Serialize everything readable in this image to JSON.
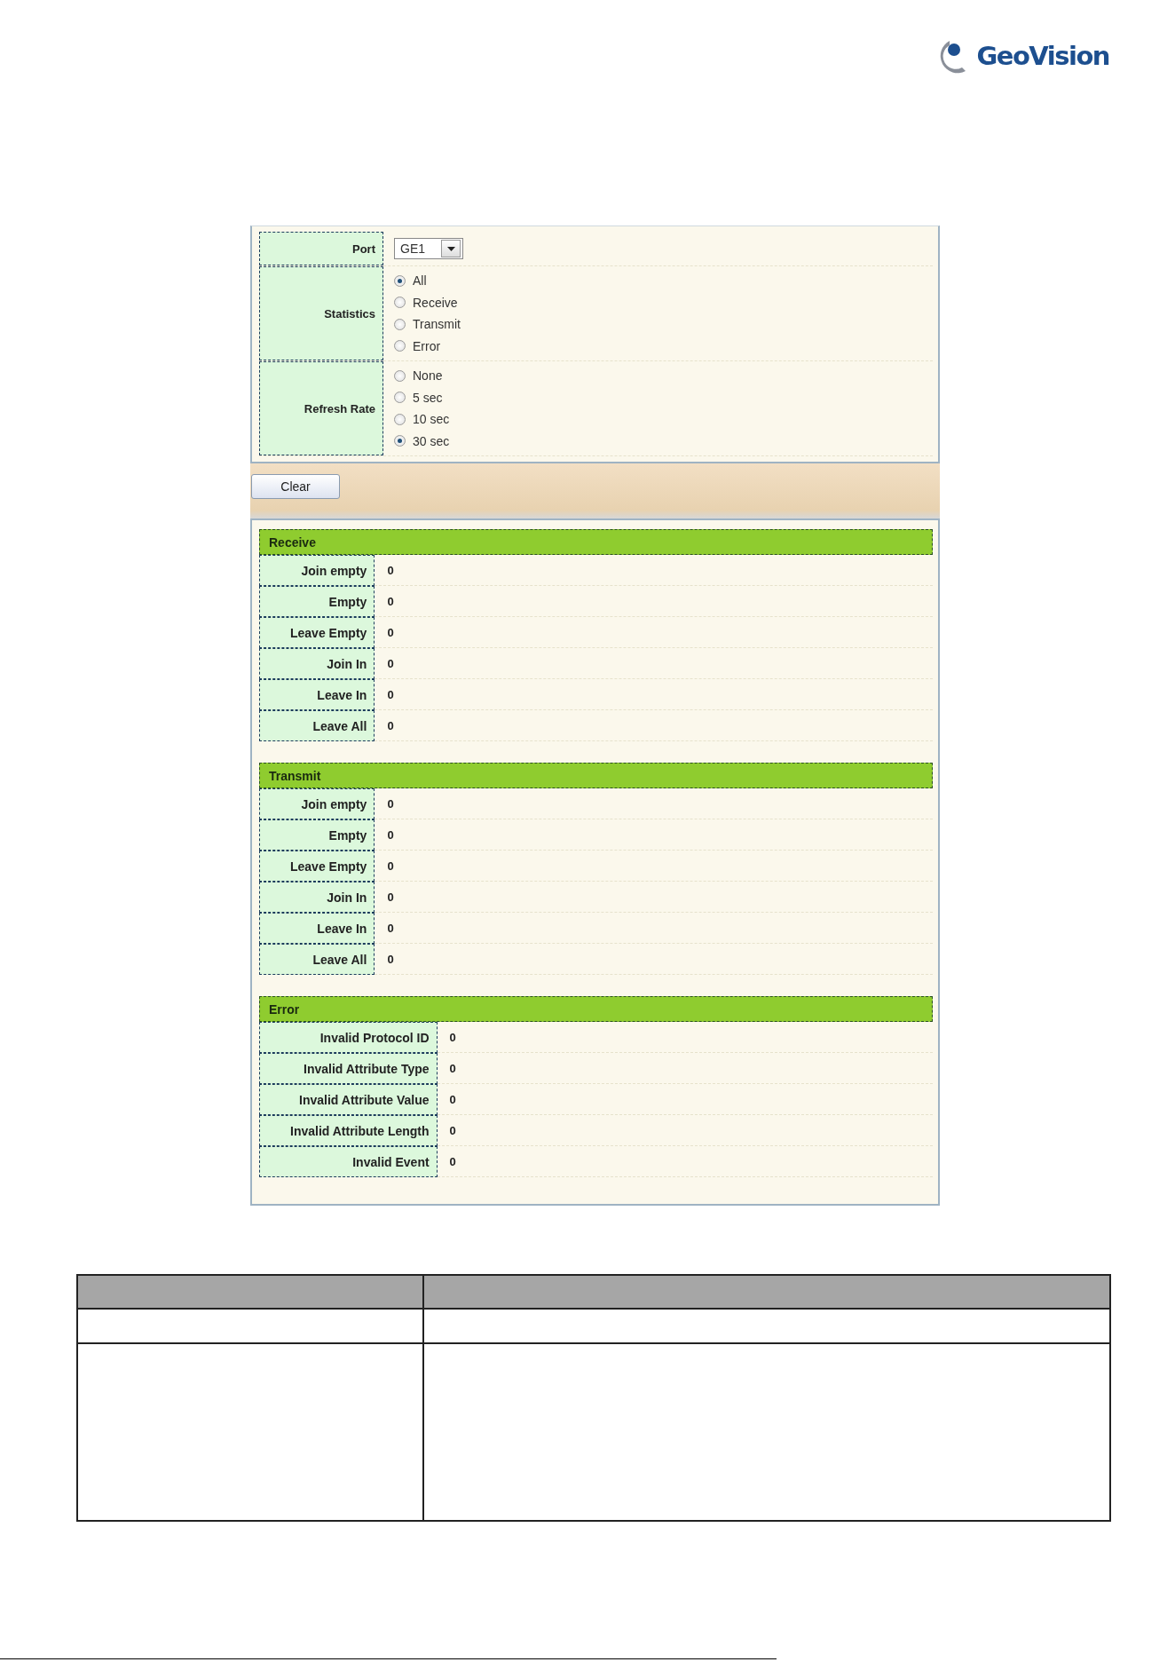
{
  "logo": {
    "text": "GeoVision"
  },
  "settings": {
    "port": {
      "label": "Port",
      "value": "GE1"
    },
    "statistics": {
      "label": "Statistics",
      "options": [
        {
          "label": "All",
          "selected": true
        },
        {
          "label": "Receive",
          "selected": false
        },
        {
          "label": "Transmit",
          "selected": false
        },
        {
          "label": "Error",
          "selected": false
        }
      ]
    },
    "refresh_rate": {
      "label": "Refresh Rate",
      "options": [
        {
          "label": "None",
          "selected": false
        },
        {
          "label": "5 sec",
          "selected": false
        },
        {
          "label": "10 sec",
          "selected": false
        },
        {
          "label": "30 sec",
          "selected": true
        }
      ]
    }
  },
  "clear_button": {
    "label": "Clear"
  },
  "sections": [
    {
      "title": "Receive",
      "rows": [
        {
          "label": "Join empty",
          "value": "0"
        },
        {
          "label": "Empty",
          "value": "0"
        },
        {
          "label": "Leave Empty",
          "value": "0"
        },
        {
          "label": "Join In",
          "value": "0"
        },
        {
          "label": "Leave In",
          "value": "0"
        },
        {
          "label": "Leave All",
          "value": "0"
        }
      ]
    },
    {
      "title": "Transmit",
      "rows": [
        {
          "label": "Join empty",
          "value": "0"
        },
        {
          "label": "Empty",
          "value": "0"
        },
        {
          "label": "Leave Empty",
          "value": "0"
        },
        {
          "label": "Join In",
          "value": "0"
        },
        {
          "label": "Leave In",
          "value": "0"
        },
        {
          "label": "Leave All",
          "value": "0"
        }
      ]
    },
    {
      "title": "Error",
      "rows": [
        {
          "label": "Invalid Protocol ID",
          "value": "0"
        },
        {
          "label": "Invalid Attribute Type",
          "value": "0"
        },
        {
          "label": "Invalid Attribute Value",
          "value": "0"
        },
        {
          "label": "Invalid Attribute Length",
          "value": "0"
        },
        {
          "label": "Invalid Event",
          "value": "0"
        }
      ]
    }
  ]
}
